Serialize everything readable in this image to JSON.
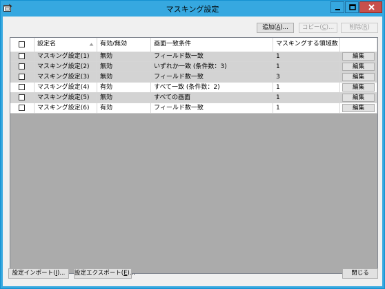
{
  "window": {
    "title": "マスキング設定",
    "icons": {
      "app": "app-window-icon",
      "minimize": "minimize-icon",
      "maximize": "maximize-icon",
      "close": "close-icon"
    }
  },
  "toolbar": {
    "add": {
      "label": "追加(",
      "mnemonic": "A",
      "suffix": ")..."
    },
    "copy": {
      "label": "コピー(",
      "mnemonic": "C",
      "suffix": ")..."
    },
    "delete": {
      "label": "削除(",
      "mnemonic": "R",
      "suffix": ")"
    }
  },
  "table": {
    "headers": [
      "",
      "設定名",
      "有効/無効",
      "画面一致条件",
      "マスキングする領域数",
      ""
    ],
    "sort_icon": "sort-ascending-icon",
    "edit_label": "編集",
    "rows": [
      {
        "name": "マスキング設定(1)",
        "status": "無効",
        "condition": "フィールド数一致",
        "count": "1",
        "shade": "gray"
      },
      {
        "name": "マスキング設定(2)",
        "status": "無効",
        "condition": "いずれか一致 (条件数：3)",
        "count": "1",
        "shade": "gray"
      },
      {
        "name": "マスキング設定(3)",
        "status": "無効",
        "condition": "フィールド数一致",
        "count": "3",
        "shade": "gray"
      },
      {
        "name": "マスキング設定(4)",
        "status": "有効",
        "condition": "すべて一致 (条件数：2)",
        "count": "1",
        "shade": "white"
      },
      {
        "name": "マスキング設定(5)",
        "status": "無効",
        "condition": "すべての画面",
        "count": "1",
        "shade": "gray"
      },
      {
        "name": "マスキング設定(6)",
        "status": "有効",
        "condition": "フィールド数一致",
        "count": "1",
        "shade": "white"
      }
    ]
  },
  "footer": {
    "import": {
      "label": "設定インポート(",
      "mnemonic": "I",
      "suffix": ")..."
    },
    "export": {
      "label": "設定エクスポート(",
      "mnemonic": "E",
      "suffix": ")..."
    },
    "close": "閉じる"
  },
  "colors": {
    "titlebar": "#36a8e0",
    "close_button": "#c7504b",
    "row_gray": "#d3d3d3",
    "grid_empty": "#ababab"
  }
}
